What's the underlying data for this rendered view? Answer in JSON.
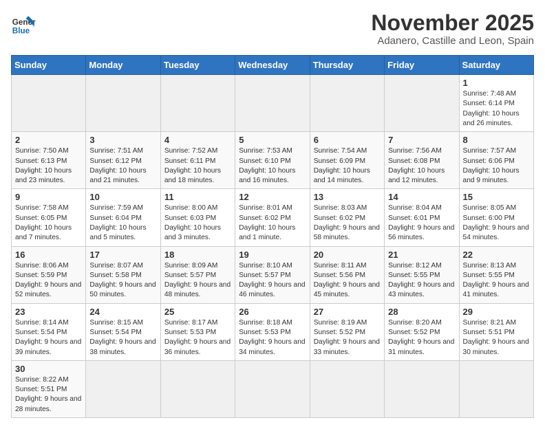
{
  "header": {
    "logo_line1": "General",
    "logo_line2": "Blue",
    "month": "November 2025",
    "location": "Adanero, Castille and Leon, Spain"
  },
  "weekdays": [
    "Sunday",
    "Monday",
    "Tuesday",
    "Wednesday",
    "Thursday",
    "Friday",
    "Saturday"
  ],
  "weeks": [
    [
      {
        "day": "",
        "info": ""
      },
      {
        "day": "",
        "info": ""
      },
      {
        "day": "",
        "info": ""
      },
      {
        "day": "",
        "info": ""
      },
      {
        "day": "",
        "info": ""
      },
      {
        "day": "",
        "info": ""
      },
      {
        "day": "1",
        "info": "Sunrise: 7:48 AM\nSunset: 6:14 PM\nDaylight: 10 hours and 26 minutes."
      }
    ],
    [
      {
        "day": "2",
        "info": "Sunrise: 7:50 AM\nSunset: 6:13 PM\nDaylight: 10 hours and 23 minutes."
      },
      {
        "day": "3",
        "info": "Sunrise: 7:51 AM\nSunset: 6:12 PM\nDaylight: 10 hours and 21 minutes."
      },
      {
        "day": "4",
        "info": "Sunrise: 7:52 AM\nSunset: 6:11 PM\nDaylight: 10 hours and 18 minutes."
      },
      {
        "day": "5",
        "info": "Sunrise: 7:53 AM\nSunset: 6:10 PM\nDaylight: 10 hours and 16 minutes."
      },
      {
        "day": "6",
        "info": "Sunrise: 7:54 AM\nSunset: 6:09 PM\nDaylight: 10 hours and 14 minutes."
      },
      {
        "day": "7",
        "info": "Sunrise: 7:56 AM\nSunset: 6:08 PM\nDaylight: 10 hours and 12 minutes."
      },
      {
        "day": "8",
        "info": "Sunrise: 7:57 AM\nSunset: 6:06 PM\nDaylight: 10 hours and 9 minutes."
      }
    ],
    [
      {
        "day": "9",
        "info": "Sunrise: 7:58 AM\nSunset: 6:05 PM\nDaylight: 10 hours and 7 minutes."
      },
      {
        "day": "10",
        "info": "Sunrise: 7:59 AM\nSunset: 6:04 PM\nDaylight: 10 hours and 5 minutes."
      },
      {
        "day": "11",
        "info": "Sunrise: 8:00 AM\nSunset: 6:03 PM\nDaylight: 10 hours and 3 minutes."
      },
      {
        "day": "12",
        "info": "Sunrise: 8:01 AM\nSunset: 6:02 PM\nDaylight: 10 hours and 1 minute."
      },
      {
        "day": "13",
        "info": "Sunrise: 8:03 AM\nSunset: 6:02 PM\nDaylight: 9 hours and 58 minutes."
      },
      {
        "day": "14",
        "info": "Sunrise: 8:04 AM\nSunset: 6:01 PM\nDaylight: 9 hours and 56 minutes."
      },
      {
        "day": "15",
        "info": "Sunrise: 8:05 AM\nSunset: 6:00 PM\nDaylight: 9 hours and 54 minutes."
      }
    ],
    [
      {
        "day": "16",
        "info": "Sunrise: 8:06 AM\nSunset: 5:59 PM\nDaylight: 9 hours and 52 minutes."
      },
      {
        "day": "17",
        "info": "Sunrise: 8:07 AM\nSunset: 5:58 PM\nDaylight: 9 hours and 50 minutes."
      },
      {
        "day": "18",
        "info": "Sunrise: 8:09 AM\nSunset: 5:57 PM\nDaylight: 9 hours and 48 minutes."
      },
      {
        "day": "19",
        "info": "Sunrise: 8:10 AM\nSunset: 5:57 PM\nDaylight: 9 hours and 46 minutes."
      },
      {
        "day": "20",
        "info": "Sunrise: 8:11 AM\nSunset: 5:56 PM\nDaylight: 9 hours and 45 minutes."
      },
      {
        "day": "21",
        "info": "Sunrise: 8:12 AM\nSunset: 5:55 PM\nDaylight: 9 hours and 43 minutes."
      },
      {
        "day": "22",
        "info": "Sunrise: 8:13 AM\nSunset: 5:55 PM\nDaylight: 9 hours and 41 minutes."
      }
    ],
    [
      {
        "day": "23",
        "info": "Sunrise: 8:14 AM\nSunset: 5:54 PM\nDaylight: 9 hours and 39 minutes."
      },
      {
        "day": "24",
        "info": "Sunrise: 8:15 AM\nSunset: 5:54 PM\nDaylight: 9 hours and 38 minutes."
      },
      {
        "day": "25",
        "info": "Sunrise: 8:17 AM\nSunset: 5:53 PM\nDaylight: 9 hours and 36 minutes."
      },
      {
        "day": "26",
        "info": "Sunrise: 8:18 AM\nSunset: 5:53 PM\nDaylight: 9 hours and 34 minutes."
      },
      {
        "day": "27",
        "info": "Sunrise: 8:19 AM\nSunset: 5:52 PM\nDaylight: 9 hours and 33 minutes."
      },
      {
        "day": "28",
        "info": "Sunrise: 8:20 AM\nSunset: 5:52 PM\nDaylight: 9 hours and 31 minutes."
      },
      {
        "day": "29",
        "info": "Sunrise: 8:21 AM\nSunset: 5:51 PM\nDaylight: 9 hours and 30 minutes."
      }
    ],
    [
      {
        "day": "30",
        "info": "Sunrise: 8:22 AM\nSunset: 5:51 PM\nDaylight: 9 hours and 28 minutes."
      },
      {
        "day": "",
        "info": ""
      },
      {
        "day": "",
        "info": ""
      },
      {
        "day": "",
        "info": ""
      },
      {
        "day": "",
        "info": ""
      },
      {
        "day": "",
        "info": ""
      },
      {
        "day": "",
        "info": ""
      }
    ]
  ]
}
